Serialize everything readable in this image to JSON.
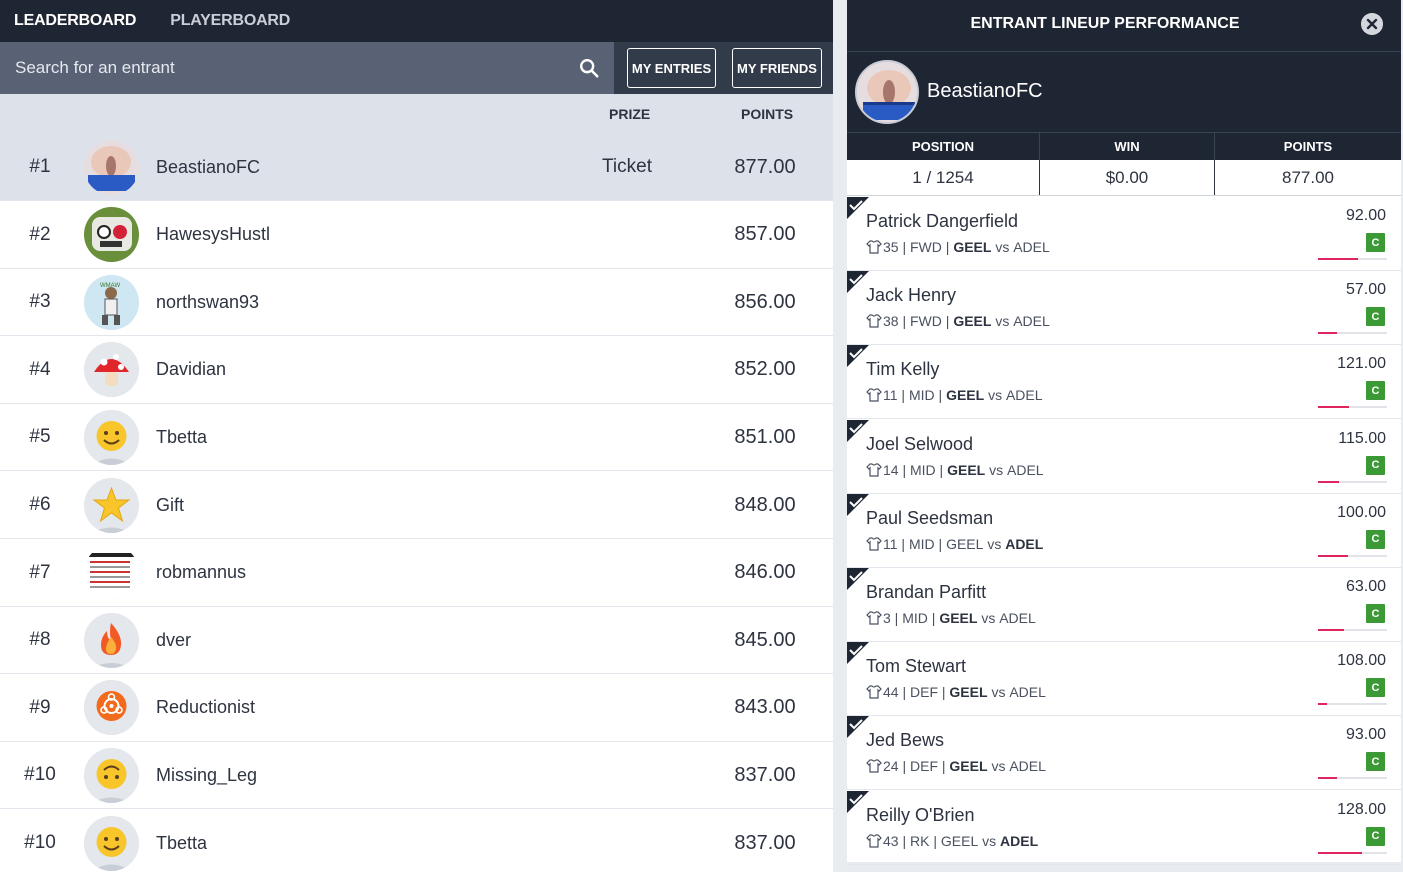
{
  "nav": {
    "tabs": [
      {
        "label": "LEADERBOARD"
      },
      {
        "label": "PLAYERBOARD"
      }
    ]
  },
  "search": {
    "placeholder": "Search for an entrant",
    "my_entries": "MY ENTRIES",
    "my_friends": "MY FRIENDS"
  },
  "columns": {
    "prize": "PRIZE",
    "points": "POINTS"
  },
  "leaderboard": [
    {
      "rank": "#1",
      "name": "BeastianoFC",
      "prize": "Ticket",
      "points": "877.00",
      "avatar": "photo-avatar"
    },
    {
      "rank": "#2",
      "name": "HawesysHustl",
      "prize": "",
      "points": "857.00",
      "avatar": "cartoon-avatar"
    },
    {
      "rank": "#3",
      "name": "northswan93",
      "prize": "",
      "points": "856.00",
      "avatar": "figure-avatar"
    },
    {
      "rank": "#4",
      "name": "Davidian",
      "prize": "",
      "points": "852.00",
      "avatar": "mushroom-icon"
    },
    {
      "rank": "#5",
      "name": "Tbetta",
      "prize": "",
      "points": "851.00",
      "avatar": "smiley-icon"
    },
    {
      "rank": "#6",
      "name": "Gift",
      "prize": "",
      "points": "848.00",
      "avatar": "star-icon"
    },
    {
      "rank": "#7",
      "name": "robmannus",
      "prize": "",
      "points": "846.00",
      "avatar": "screenshot-avatar"
    },
    {
      "rank": "#8",
      "name": "dver",
      "prize": "",
      "points": "845.00",
      "avatar": "fire-icon"
    },
    {
      "rank": "#9",
      "name": "Reductionist",
      "prize": "",
      "points": "843.00",
      "avatar": "biohazard-icon"
    },
    {
      "rank": "#10",
      "name": "Missing_Leg",
      "prize": "",
      "points": "837.00",
      "avatar": "upside-down-smiley-icon"
    },
    {
      "rank": "#10",
      "name": "Tbetta",
      "prize": "",
      "points": "837.00",
      "avatar": "smiley-icon"
    }
  ],
  "panel": {
    "title": "ENTRANT LINEUP PERFORMANCE",
    "entrant": "BeastianoFC",
    "stats_labels": {
      "position": "POSITION",
      "win": "WIN",
      "points": "POINTS"
    },
    "stats_values": {
      "position": "1 / 1254",
      "win": "$0.00",
      "points": "877.00"
    },
    "players": [
      {
        "name": "Patrick Dangerfield",
        "number": "35",
        "pos": "FWD",
        "home": "GEEL",
        "vs": "vs",
        "away": "ADEL",
        "bold": "home",
        "points": "92.00",
        "badge": "C",
        "progress": 0.58
      },
      {
        "name": "Jack Henry",
        "number": "38",
        "pos": "FWD",
        "home": "GEEL",
        "vs": "vs",
        "away": "ADEL",
        "bold": "home",
        "points": "57.00",
        "badge": "C",
        "progress": 0.28
      },
      {
        "name": "Tim Kelly",
        "number": "11",
        "pos": "MID",
        "home": "GEEL",
        "vs": "vs",
        "away": "ADEL",
        "bold": "home",
        "points": "121.00",
        "badge": "C",
        "progress": 0.45
      },
      {
        "name": "Joel Selwood",
        "number": "14",
        "pos": "MID",
        "home": "GEEL",
        "vs": "vs",
        "away": "ADEL",
        "bold": "home",
        "points": "115.00",
        "badge": "C",
        "progress": 0.3
      },
      {
        "name": "Paul Seedsman",
        "number": "11",
        "pos": "MID",
        "home": "GEEL",
        "vs": "vs",
        "away": "ADEL",
        "bold": "away",
        "points": "100.00",
        "badge": "C",
        "progress": 0.43
      },
      {
        "name": "Brandan Parfitt",
        "number": "3",
        "pos": "MID",
        "home": "GEEL",
        "vs": "vs",
        "away": "ADEL",
        "bold": "home",
        "points": "63.00",
        "badge": "C",
        "progress": 0.37
      },
      {
        "name": "Tom Stewart",
        "number": "44",
        "pos": "DEF",
        "home": "GEEL",
        "vs": "vs",
        "away": "ADEL",
        "bold": "home",
        "points": "108.00",
        "badge": "C",
        "progress": 0.13
      },
      {
        "name": "Jed Bews",
        "number": "24",
        "pos": "DEF",
        "home": "GEEL",
        "vs": "vs",
        "away": "ADEL",
        "bold": "home",
        "points": "93.00",
        "badge": "C",
        "progress": 0.27
      },
      {
        "name": "Reilly O'Brien",
        "number": "43",
        "pos": "RK",
        "home": "GEEL",
        "vs": "vs",
        "away": "ADEL",
        "bold": "away",
        "points": "128.00",
        "badge": "C",
        "progress": 0.64
      }
    ]
  },
  "colors": {
    "dark": "#1f2633",
    "search": "#586274",
    "highlight": "#dde1ea",
    "badge": "#3c9a36",
    "bar": "#e0245e"
  }
}
